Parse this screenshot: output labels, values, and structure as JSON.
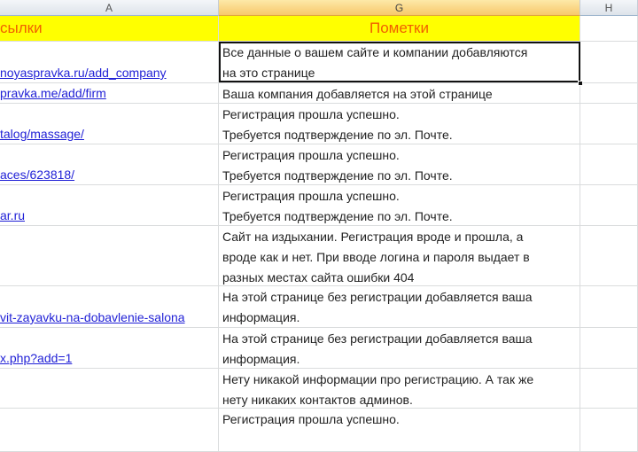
{
  "columns": [
    "A",
    "G",
    "H"
  ],
  "title_row": {
    "a": "сылки",
    "g": "Пометки"
  },
  "rows": [
    {
      "link": "noyaspravka.ru/add_company",
      "note": "Все данные о вашем сайте и компании добавляются\nна это странице"
    },
    {
      "link": "pravka.me/add/firm",
      "note": "Ваша компания добавляется на этой странице"
    },
    {
      "link": "talog/massage/",
      "note": "Регистрация прошла успешно.\nТребуется подтверждение по эл. Почте."
    },
    {
      "link": "aces/623818/",
      "note": "Регистрация прошла успешно.\nТребуется подтверждение по эл. Почте."
    },
    {
      "link": "ar.ru",
      "note": "Регистрация прошла успешно.\nТребуется подтверждение по эл. Почте."
    },
    {
      "link": "",
      "note": "Сайт на издыхании.  Регистрация вроде и прошла, а\nвроде как и нет.  При вводе логина и пароля выдает в\nразных местах сайта ошибки 404"
    },
    {
      "link": "vit-zayavku-na-dobavlenie-salona",
      "note": "На этой странице без регистрации добавляется ваша\nинформация."
    },
    {
      "link": "x.php?add=1",
      "note": "На этой странице без регистрации добавляется ваша\nинформация."
    },
    {
      "link": "",
      "note": "Нету никакой информации про регистрацию.  А так же\nнету никаких контактов админов."
    },
    {
      "link": "",
      "note": "Регистрация прошла успешно."
    }
  ]
}
